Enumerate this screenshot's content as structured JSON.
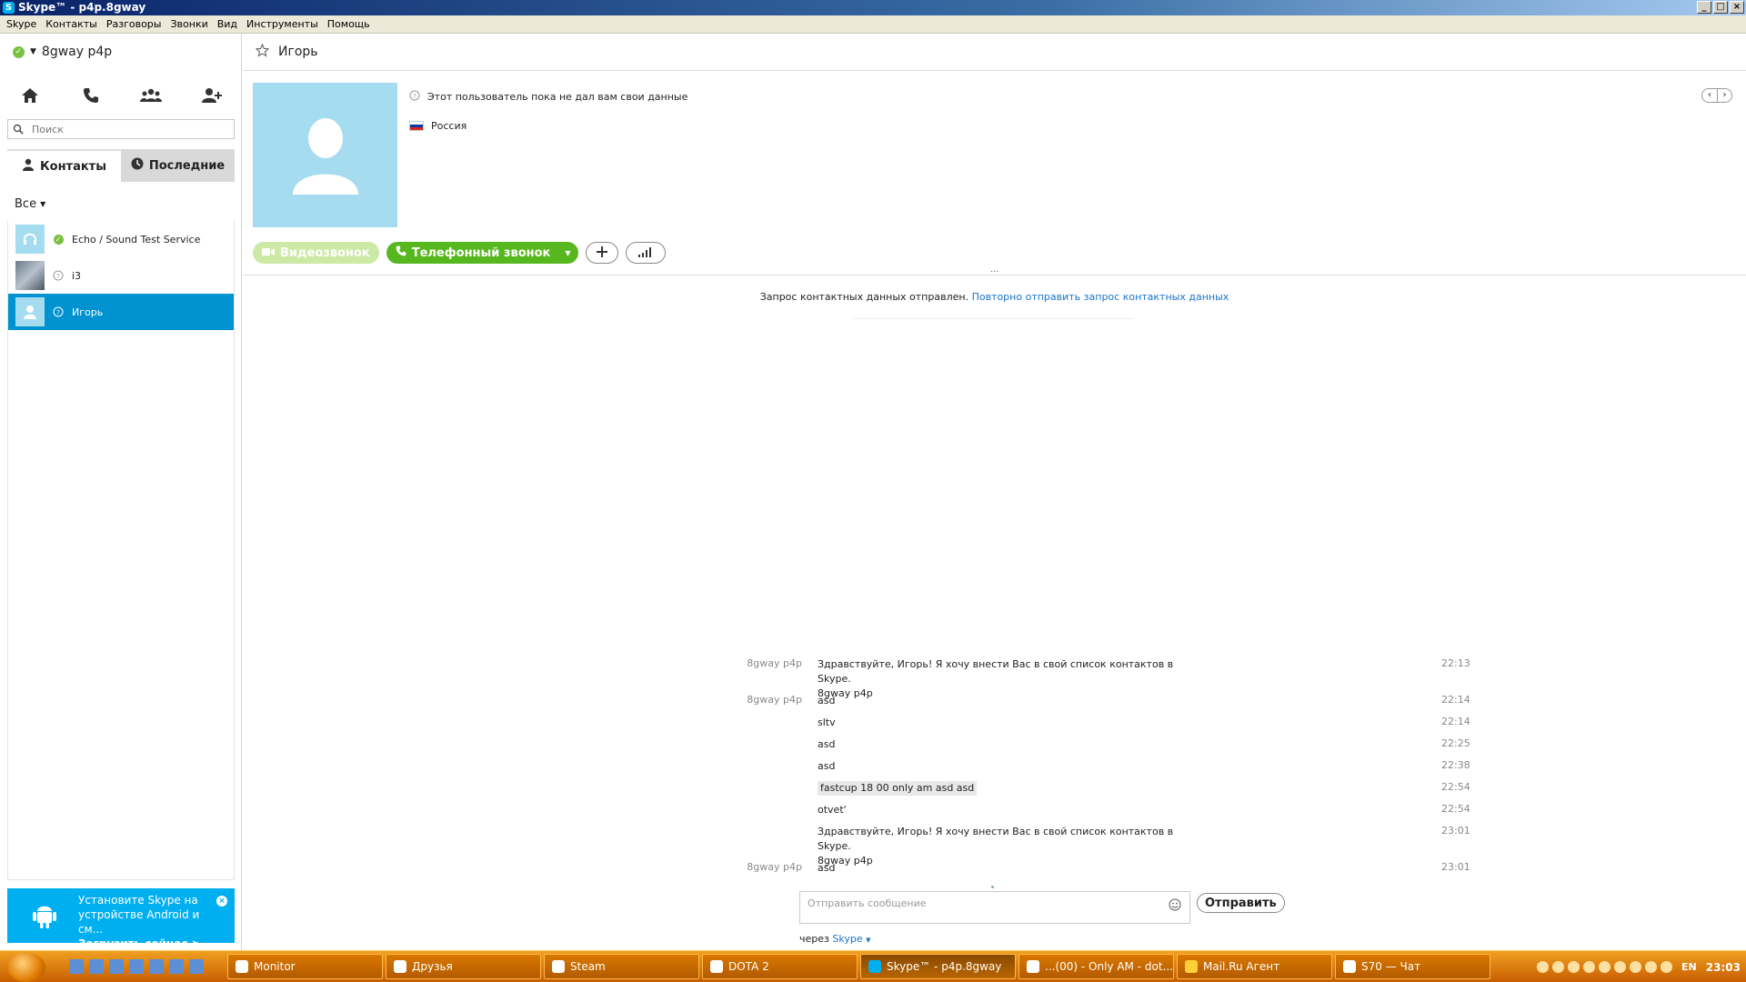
{
  "window": {
    "title": "Skype™ - p4p.8gway"
  },
  "menu": [
    "Skype",
    "Контакты",
    "Разговоры",
    "Звонки",
    "Вид",
    "Инструменты",
    "Помощь"
  ],
  "profile": {
    "name": "8gway p4p"
  },
  "search": {
    "placeholder": "Поиск"
  },
  "tabs": {
    "contacts": "Контакты",
    "recent": "Последние"
  },
  "filter": {
    "label": "Все"
  },
  "contacts": [
    {
      "name": "Echo / Sound Test Service"
    },
    {
      "name": "i3"
    },
    {
      "name": "Игорь"
    }
  ],
  "promo": {
    "line1": "Установите Skype на",
    "line2": "устройстве Android и см...",
    "link": "Загрузить сейчас >"
  },
  "conversation": {
    "title": "Игорь",
    "info": "Этот пользователь пока не дал вам свои данные",
    "country": "Россия",
    "video_label": "Видеозвонок",
    "call_label": "Телефонный звонок",
    "notice_text": "Запрос контактных данных отправлен.",
    "notice_link": "Повторно отправить запрос контактных данных",
    "ellipsis": "..."
  },
  "messages": [
    {
      "sender": "8gway p4p",
      "text": "Здравствуйте, Игорь! Я хочу внести Вас в свой список контактов в Skype.",
      "text2": "8gway p4p",
      "time": "22:13"
    },
    {
      "sender": "8gway p4p",
      "text": "asd",
      "time": "22:14"
    },
    {
      "sender": "",
      "text": "sltv",
      "time": "22:14"
    },
    {
      "sender": "",
      "text": "asd",
      "time": "22:25"
    },
    {
      "sender": "",
      "text": "asd",
      "time": "22:38"
    },
    {
      "sender": "",
      "text": "fastcup 18 00 only am asd asd",
      "time": "22:54"
    },
    {
      "sender": "",
      "text": "otvet'",
      "time": "22:54"
    },
    {
      "sender": "",
      "text": "Здравствуйте, Игорь! Я хочу внести Вас в свой список контактов в Skype.",
      "text2": "8gway p4p",
      "time": "23:01"
    },
    {
      "sender": "8gway p4p",
      "text": "asd",
      "time": "23:01"
    }
  ],
  "composer": {
    "placeholder": "Отправить сообщение",
    "send_label": "Отправить",
    "via_prefix": "через",
    "via_service": "Skype"
  },
  "taskbar": {
    "tasks": [
      "Monitor",
      "Друзья",
      "Steam",
      "DOTA 2",
      "Skype™ - p4p.8gway",
      "...(00) - Only AM - dot...",
      "Mail.Ru Агент",
      "S70 — Чат"
    ],
    "lang": "EN",
    "clock": "23:03"
  },
  "colors": {
    "skype_blue": "#00aff0",
    "selected": "#0092d1",
    "call_green": "#57b71e",
    "link": "#1a74c8",
    "online": "#7ac143"
  }
}
